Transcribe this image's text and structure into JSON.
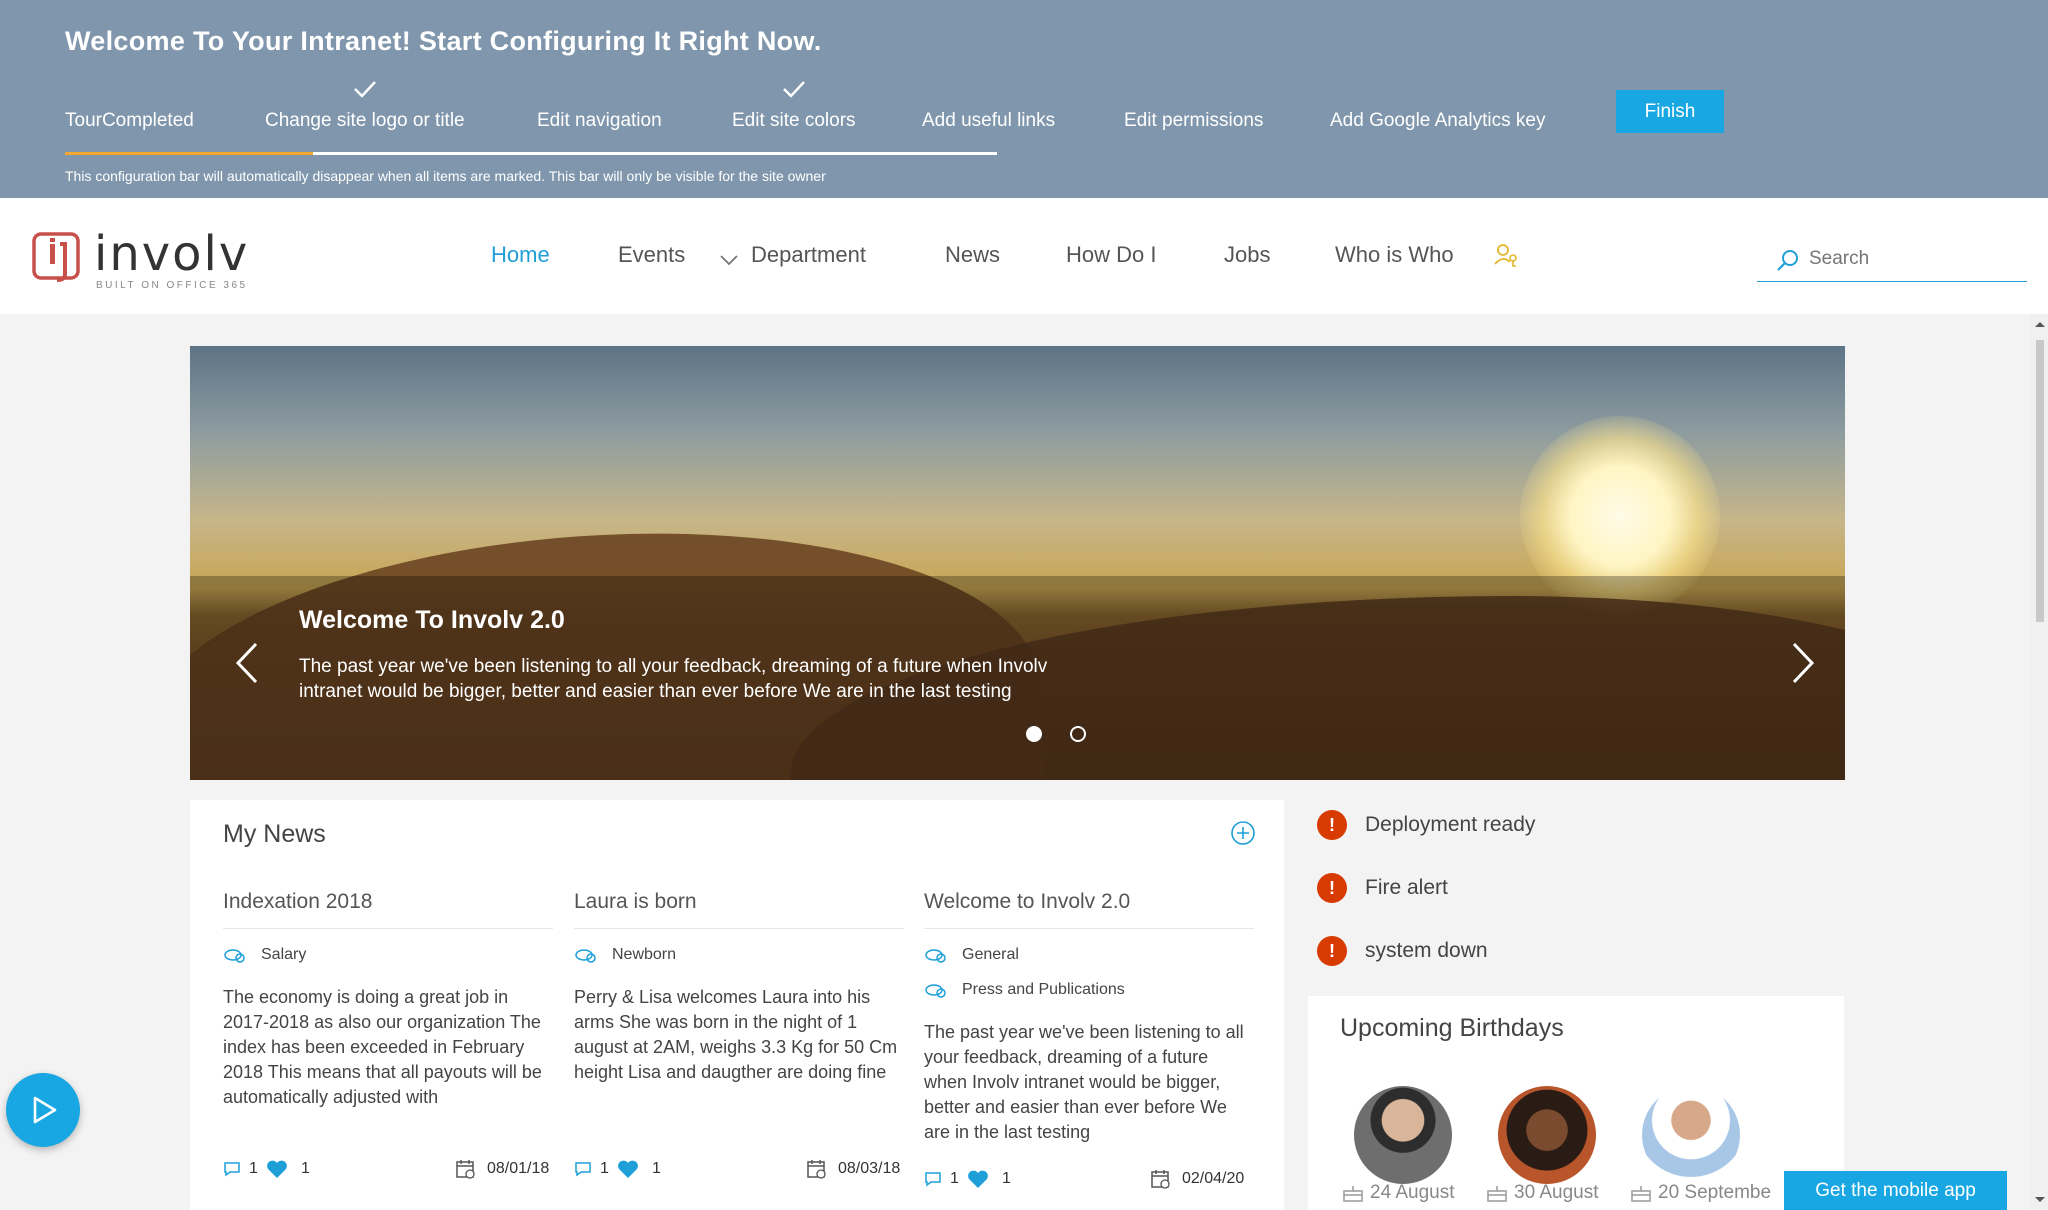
{
  "config": {
    "title": "Welcome To Your Intranet! Start Configuring It Right Now.",
    "steps": [
      {
        "label": "TourCompleted",
        "done": false
      },
      {
        "label": "Change site logo or title",
        "done": true
      },
      {
        "label": "Edit navigation",
        "done": false
      },
      {
        "label": "Edit site colors",
        "done": true
      },
      {
        "label": "Add useful links",
        "done": false
      },
      {
        "label": "Edit permissions",
        "done": false
      },
      {
        "label": "Add Google Analytics key",
        "done": false
      }
    ],
    "finish_label": "Finish",
    "note": "This configuration bar will automatically disappear when all items are marked. This bar will only be visible for the site owner",
    "accent": "#f0a830"
  },
  "header": {
    "logo_text": "involv",
    "logo_sub": "BUILT ON OFFICE 365",
    "nav": [
      "Home",
      "Events",
      "Department",
      "News",
      "How Do I",
      "Jobs",
      "Who is Who"
    ],
    "active_nav": "Home",
    "search_placeholder": "Search",
    "accent": "#1e9fd8"
  },
  "hero": {
    "title": "Welcome To Involv 2.0",
    "text": "The past year we've been listening to all your feedback, dreaming of a future when Involv intranet would be bigger, better and easier than ever before We are in the last testing",
    "slides": 2,
    "active_slide": 1
  },
  "news": {
    "title": "My News",
    "items": [
      {
        "title": "Indexation 2018",
        "tags": [
          "Salary"
        ],
        "body": "The economy is doing a great job in 2017-2018 as also our organization The index has been exceeded in February 2018 This means that all payouts will be automatically adjusted with",
        "comments": "1",
        "likes": "1",
        "date": "08/01/18"
      },
      {
        "title": "Laura is born",
        "tags": [
          "Newborn"
        ],
        "body": "Perry & Lisa welcomes Laura into his arms She was born in the night of 1 august at 2AM, weighs 3.3 Kg for 50 Cm height Lisa and daugther are doing fine",
        "comments": "1",
        "likes": "1",
        "date": "08/03/18"
      },
      {
        "title": "Welcome to Involv 2.0",
        "tags": [
          "General",
          "Press and Publications"
        ],
        "body": "The past year we've been listening to all your feedback, dreaming of a future when Involv intranet would be bigger, better and easier than ever before We are in the last testing",
        "comments": "1",
        "likes": "1",
        "date": "02/04/20"
      }
    ]
  },
  "alerts": [
    "Deployment ready",
    "Fire alert",
    "system down"
  ],
  "birthdays": {
    "title": "Upcoming Birthdays",
    "people": [
      {
        "date": "24 August"
      },
      {
        "date": "30 August"
      },
      {
        "date": "20 Septembe"
      }
    ]
  },
  "mobile_app_label": "Get the mobile app"
}
